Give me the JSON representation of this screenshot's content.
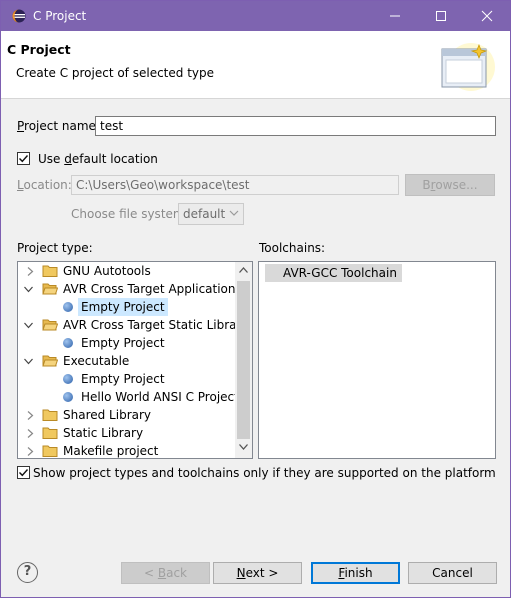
{
  "window": {
    "title": "C Project"
  },
  "banner": {
    "title": "C Project",
    "subtitle": "Create C project of selected type"
  },
  "project_name": {
    "label": "Project name:",
    "value": "test"
  },
  "default_location": {
    "label": "Use default location",
    "checked": true
  },
  "location": {
    "label": "Location:",
    "value": "C:\\Users\\Geo\\workspace\\test",
    "browse_label": "Browse..."
  },
  "file_system": {
    "label": "Choose file system:",
    "value": "default"
  },
  "project_type": {
    "label": "Project type:",
    "items": [
      {
        "label": "GNU Autotools",
        "kind": "folder",
        "expanded": false,
        "level": 0
      },
      {
        "label": "AVR Cross Target Application",
        "kind": "folder",
        "expanded": true,
        "level": 0
      },
      {
        "label": "Empty Project",
        "kind": "item",
        "level": 1,
        "selected": true
      },
      {
        "label": "AVR Cross Target Static Library",
        "kind": "folder",
        "expanded": true,
        "level": 0
      },
      {
        "label": "Empty Project",
        "kind": "item",
        "level": 1
      },
      {
        "label": "Executable",
        "kind": "folder",
        "expanded": true,
        "level": 0
      },
      {
        "label": "Empty Project",
        "kind": "item",
        "level": 1
      },
      {
        "label": "Hello World ANSI C Project",
        "kind": "item",
        "level": 1
      },
      {
        "label": "Shared Library",
        "kind": "folder",
        "expanded": false,
        "level": 0
      },
      {
        "label": "Static Library",
        "kind": "folder",
        "expanded": false,
        "level": 0
      },
      {
        "label": "Makefile project",
        "kind": "folder",
        "expanded": false,
        "level": 0
      }
    ]
  },
  "toolchains": {
    "label": "Toolchains:",
    "items": [
      "AVR-GCC Toolchain"
    ]
  },
  "show_supported": {
    "label": "Show project types and toolchains only if they are supported on the platform",
    "checked": true
  },
  "buttons": {
    "help": "?",
    "back": "< Back",
    "next": "Next >",
    "finish": "Finish",
    "cancel": "Cancel"
  },
  "colors": {
    "titlebar": "#7e64b0",
    "selection": "#cce8ff",
    "default_button_border": "#0078d7"
  }
}
